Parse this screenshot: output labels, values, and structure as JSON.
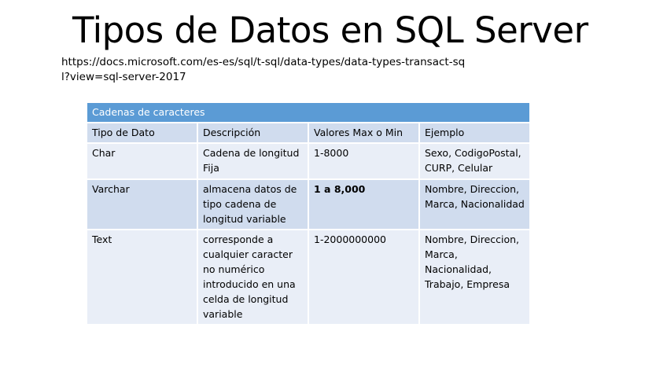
{
  "title": "Tipos de Datos en SQL Server",
  "url": "https://docs.microsoft.com/es-es/sql/t-sql/data-types/data-types-transact-sql?view=sql-server-2017",
  "table": {
    "caption": "Cadenas de caracteres",
    "headers": [
      "Tipo de Dato",
      "Descripción",
      "Valores Max o Min",
      "Ejemplo"
    ],
    "rows": [
      [
        "Char",
        "Cadena de longitud Fija",
        "1-8000",
        "Sexo, CodigoPostal, CURP, Celular"
      ],
      [
        "Varchar",
        "almacena datos de tipo cadena de longitud variable",
        "1 a 8,000",
        "Nombre, Direccion, Marca, Nacionalidad"
      ],
      [
        "Text",
        "corresponde a cualquier caracter no numérico introducido en una celda de longitud variable",
        "1-2000000000",
        "Nombre, Direccion, Marca, Nacionalidad, Trabajo, Empresa"
      ]
    ]
  }
}
